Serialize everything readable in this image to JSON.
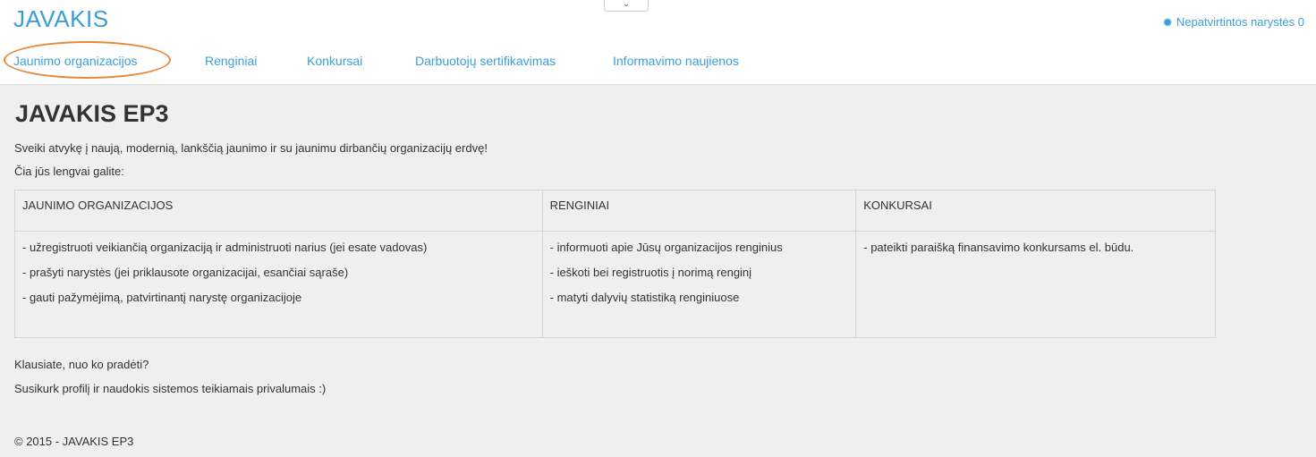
{
  "header": {
    "brand": "JAVAKIS",
    "collapse_icon": "chevron-down-icon",
    "unconfirmed_icon": "gear-icon",
    "unconfirmed_label": "Nepatvirtintos narystės 0"
  },
  "nav": {
    "items": [
      {
        "label": "Jaunimo organizacijos"
      },
      {
        "label": "Renginiai"
      },
      {
        "label": "Konkursai"
      },
      {
        "label": "Darbuotojų sertifikavimas"
      },
      {
        "label": "Informavimo naujienos"
      }
    ],
    "highlight_color": "#e8883a"
  },
  "main": {
    "title": "JAVAKIS EP3",
    "welcome": "Sveiki atvykę į naują, modernią, lankščią jaunimo ir su jaunimu dirbančių organizacijų erdvę!",
    "intro": "Čia jūs lengvai galite:",
    "table": {
      "headers": [
        "JAUNIMO ORGANIZACIJOS",
        "RENGINIAI",
        "KONKURSAI"
      ],
      "columns": [
        [
          "- užregistruoti veikiančią organizaciją ir administruoti narius (jei esate vadovas)",
          "- prašyti narystės (jei priklausote organizacijai, esančiai sąraše)",
          "- gauti pažymėjimą, patvirtinantį narystę organizacijoje"
        ],
        [
          "- informuoti apie Jūsų organizacijos renginius",
          "- ieškoti bei registruotis į norimą renginį",
          "- matyti dalyvių statistiką renginiuose"
        ],
        [
          "- pateikti paraišką finansavimo konkursams el. būdu."
        ]
      ]
    },
    "question": "Klausiate, nuo ko pradėti?",
    "cta": "Susikurk profilį ir naudokis sistemos teikiamais privalumais :)"
  },
  "footer": {
    "copyright": "© 2015 - JAVAKIS EP3"
  },
  "colors": {
    "accent": "#3a9fd6",
    "background": "#efefef"
  }
}
